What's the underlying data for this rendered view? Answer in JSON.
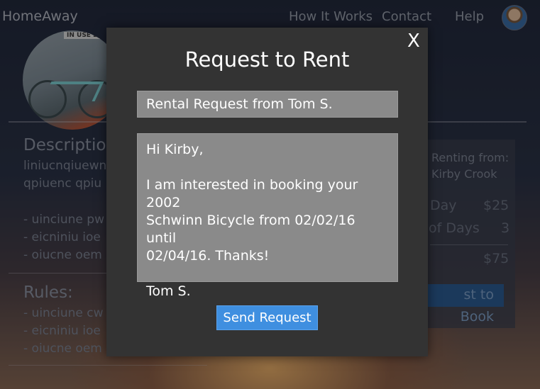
{
  "header": {
    "brand": "HomeAway",
    "nav": [
      "How It Works",
      "Contact",
      "Help"
    ]
  },
  "listing": {
    "photo_sign": "IN USE 2",
    "description_title": "Description",
    "description_lines": [
      "liniucnqiuewn",
      "qpiuenc qpiu"
    ],
    "description_bullets": [
      "- uinciune pw",
      "- eicniniu ioe",
      "- oiucne oem"
    ],
    "rules_title": "Rules:",
    "rules_bullets": [
      "- uinciune cw",
      "- eicniniu ioe",
      "- oiucne oem"
    ]
  },
  "booking_card": {
    "renting_from_label": "Renting from:",
    "owner_name": "Kirby Crook",
    "per_day_label": "Day",
    "per_day_value": "$25",
    "days_label": "of Days",
    "days_value": "3",
    "total_value": "$75",
    "request_button": "st to Book"
  },
  "modal": {
    "close_label": "X",
    "title": "Request to Rent",
    "subject_value": "Rental Request from Tom S.",
    "message_lines": [
      "Hi Kirby,",
      "",
      "I am interested in booking your 2002",
      "Schwinn Bicycle from 02/02/16 until",
      "02/04/16. Thanks!",
      "",
      "Tom S."
    ],
    "send_button": "Send Request"
  },
  "colors": {
    "modal_bg": "#333333",
    "field_bg": "#8a8a8a",
    "send_button": "#3f8fe0"
  }
}
